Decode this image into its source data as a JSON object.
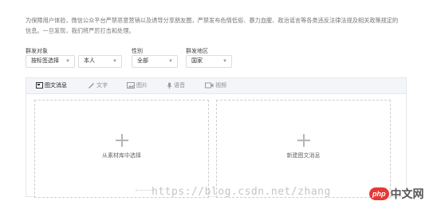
{
  "notice": {
    "line1": "为保障用户体验，微信公众平台严禁恶意营销以及诱导分享朋友圈，严禁发布色情低俗、暴力血腥、政治谣言等各类违反法律法规及相关政策规定的",
    "line2": "信息。一旦发现，我们将严厉打击和处理。"
  },
  "filters": {
    "target_label": "群发对象",
    "target_select": "按标签选择",
    "target_select2": "本人",
    "gender_label": "性别",
    "gender_select": "全部",
    "region_label": "群发地区",
    "region_select": "国家"
  },
  "tabs": {
    "news": "图文消息",
    "text": "文字",
    "image": "图片",
    "voice": "语音",
    "video": "视频"
  },
  "panels": {
    "from_library": "从素材库中选择",
    "new_news": "新建图文消息"
  },
  "watermark": {
    "url": "https://blog.csdn.net/zhang",
    "logo_php": "php",
    "logo_cn": "中文网"
  }
}
